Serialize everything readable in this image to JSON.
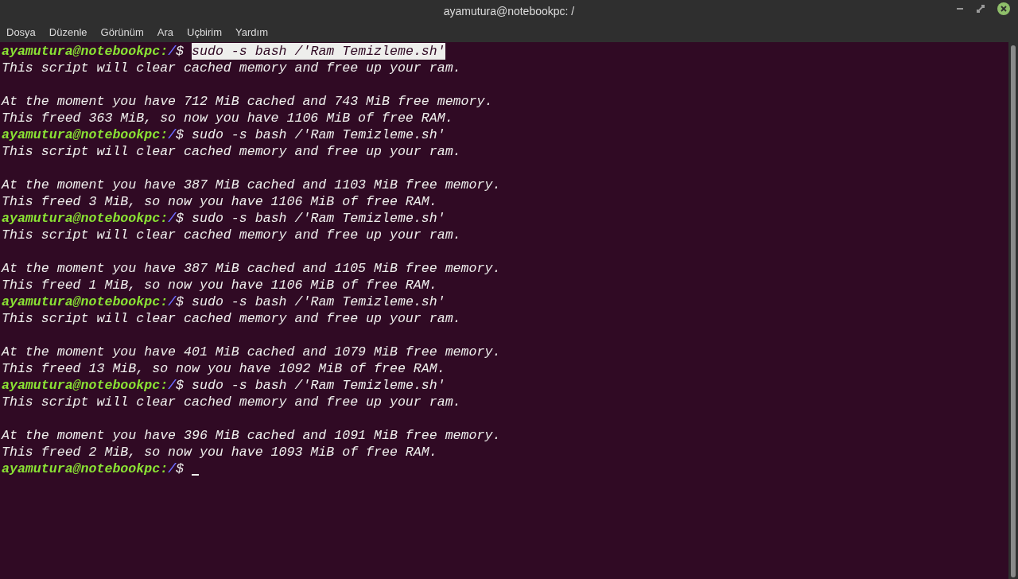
{
  "window": {
    "title": "ayamutura@notebookpc: /"
  },
  "menu": [
    "Dosya",
    "Düzenle",
    "Görünüm",
    "Ara",
    "Uçbirim",
    "Yardım"
  ],
  "lines": [
    {
      "kind": "prompt",
      "user": "ayamutura@notebookpc:",
      "path": "/",
      "sign": "$",
      "command": "sudo -s bash /'Ram Temizleme.sh'",
      "selected": true
    },
    {
      "kind": "output",
      "text": "This script will clear cached memory and free up your ram."
    },
    {
      "kind": "blank"
    },
    {
      "kind": "output",
      "text": "At the moment you have 712 MiB cached and 743 MiB free memory."
    },
    {
      "kind": "output",
      "text": "This freed 363 MiB, so now you have 1106 MiB of free RAM."
    },
    {
      "kind": "prompt",
      "user": "ayamutura@notebookpc:",
      "path": "/",
      "sign": "$",
      "command": "sudo -s bash /'Ram Temizleme.sh'",
      "selected": false
    },
    {
      "kind": "output",
      "text": "This script will clear cached memory and free up your ram."
    },
    {
      "kind": "blank"
    },
    {
      "kind": "output",
      "text": "At the moment you have 387 MiB cached and 1103 MiB free memory."
    },
    {
      "kind": "output",
      "text": "This freed 3 MiB, so now you have 1106 MiB of free RAM."
    },
    {
      "kind": "prompt",
      "user": "ayamutura@notebookpc:",
      "path": "/",
      "sign": "$",
      "command": "sudo -s bash /'Ram Temizleme.sh'",
      "selected": false
    },
    {
      "kind": "output",
      "text": "This script will clear cached memory and free up your ram."
    },
    {
      "kind": "blank"
    },
    {
      "kind": "output",
      "text": "At the moment you have 387 MiB cached and 1105 MiB free memory."
    },
    {
      "kind": "output",
      "text": "This freed 1 MiB, so now you have 1106 MiB of free RAM."
    },
    {
      "kind": "prompt",
      "user": "ayamutura@notebookpc:",
      "path": "/",
      "sign": "$",
      "command": "sudo -s bash /'Ram Temizleme.sh'",
      "selected": false
    },
    {
      "kind": "output",
      "text": "This script will clear cached memory and free up your ram."
    },
    {
      "kind": "blank"
    },
    {
      "kind": "output",
      "text": "At the moment you have 401 MiB cached and 1079 MiB free memory."
    },
    {
      "kind": "output",
      "text": "This freed 13 MiB, so now you have 1092 MiB of free RAM."
    },
    {
      "kind": "prompt",
      "user": "ayamutura@notebookpc:",
      "path": "/",
      "sign": "$",
      "command": "sudo -s bash /'Ram Temizleme.sh'",
      "selected": false
    },
    {
      "kind": "output",
      "text": "This script will clear cached memory and free up your ram."
    },
    {
      "kind": "blank"
    },
    {
      "kind": "output",
      "text": "At the moment you have 396 MiB cached and 1091 MiB free memory."
    },
    {
      "kind": "output",
      "text": "This freed 2 MiB, so now you have 1093 MiB of free RAM."
    },
    {
      "kind": "prompt",
      "user": "ayamutura@notebookpc:",
      "path": "/",
      "sign": "$",
      "cursor": true
    }
  ]
}
